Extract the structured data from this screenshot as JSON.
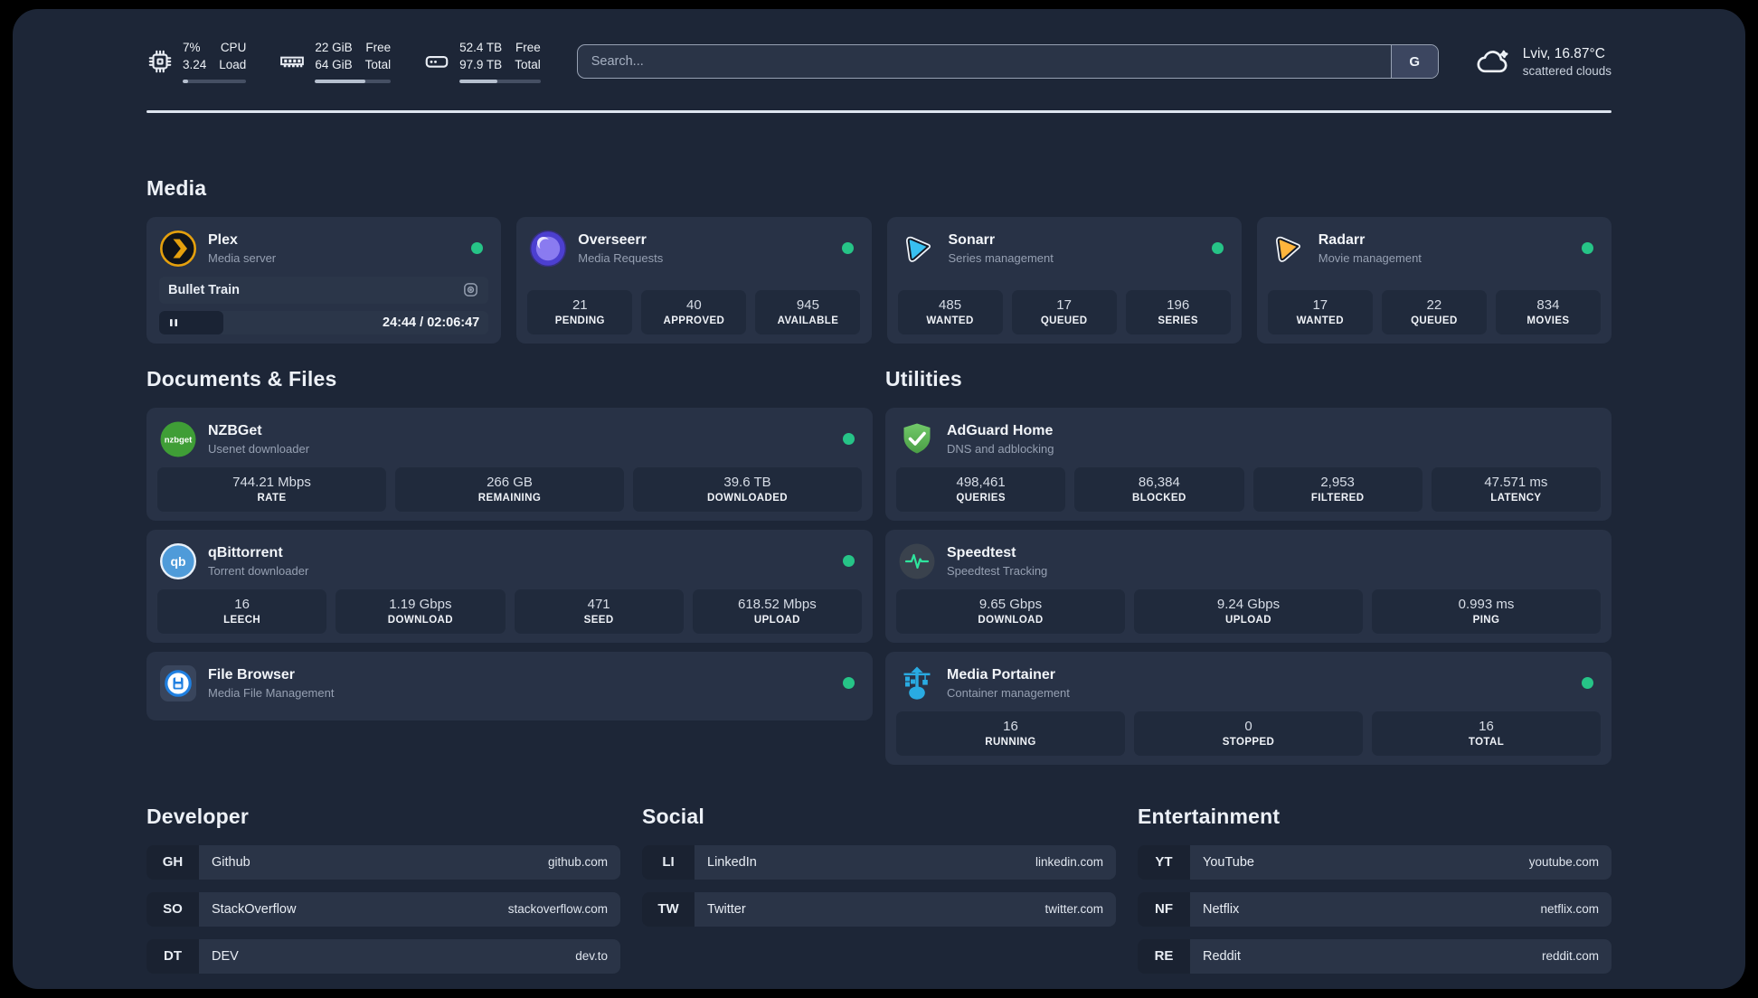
{
  "colors": {
    "status_online": "#26c487",
    "plex_orange": "#e5a00d",
    "overseerr_purple": "#8a7bf0",
    "sonarr_blue": "#38c0f0",
    "radarr_amber": "#ffb53c",
    "nzbget_green": "#3f9e36",
    "qbittorrent_blue": "#4f9bd9",
    "filebrowser_blue": "#1f7fe0",
    "adguard_green": "#5cb85a",
    "speedtest_green": "#2ee59d",
    "portainer_blue": "#29abe2"
  },
  "header": {
    "stats": [
      {
        "id": "cpu",
        "icon": "cpu-icon",
        "values": [
          "7%",
          "3.24"
        ],
        "labels": [
          "CPU",
          "Load"
        ],
        "progress_pct": 8
      },
      {
        "id": "ram",
        "icon": "ram-icon",
        "values": [
          "22 GiB",
          "64 GiB"
        ],
        "labels": [
          "Free",
          "Total"
        ],
        "progress_pct": 66
      },
      {
        "id": "disk",
        "icon": "disk-icon",
        "values": [
          "52.4 TB",
          "97.9 TB"
        ],
        "labels": [
          "Free",
          "Total"
        ],
        "progress_pct": 47
      }
    ],
    "search": {
      "placeholder": "Search...",
      "button_label": "G"
    },
    "weather": {
      "icon": "cloud-icon",
      "location": "Lviv, 16.87°C",
      "condition": "scattered clouds"
    }
  },
  "app_sections": [
    {
      "title": "Media",
      "apps": [
        {
          "id": "plex",
          "icon": "plex-icon",
          "title": "Plex",
          "subtitle": "Media server",
          "online": true,
          "now_playing": {
            "title": "Bullet Train",
            "time_display": "24:44 / 02:06:47",
            "progress_pct": 19.5
          }
        },
        {
          "id": "overseerr",
          "icon": "overseerr-icon",
          "title": "Overseerr",
          "subtitle": "Media Requests",
          "online": true,
          "stats": [
            {
              "value": "21",
              "label": "PENDING"
            },
            {
              "value": "40",
              "label": "APPROVED"
            },
            {
              "value": "945",
              "label": "AVAILABLE"
            }
          ]
        },
        {
          "id": "sonarr",
          "icon": "sonarr-icon",
          "title": "Sonarr",
          "subtitle": "Series management",
          "online": true,
          "stats": [
            {
              "value": "485",
              "label": "WANTED"
            },
            {
              "value": "17",
              "label": "QUEUED"
            },
            {
              "value": "196",
              "label": "SERIES"
            }
          ]
        },
        {
          "id": "radarr",
          "icon": "radarr-icon",
          "title": "Radarr",
          "subtitle": "Movie management",
          "online": true,
          "stats": [
            {
              "value": "17",
              "label": "WANTED"
            },
            {
              "value": "22",
              "label": "QUEUED"
            },
            {
              "value": "834",
              "label": "MOVIES"
            }
          ]
        }
      ]
    },
    {
      "title": "Documents & Files",
      "apps": [
        {
          "id": "nzbget",
          "icon": "nzbget-icon",
          "title": "NZBGet",
          "subtitle": "Usenet downloader",
          "online": true,
          "stats": [
            {
              "value": "744.21 Mbps",
              "label": "RATE"
            },
            {
              "value": "266 GB",
              "label": "REMAINING"
            },
            {
              "value": "39.6 TB",
              "label": "DOWNLOADED"
            }
          ]
        },
        {
          "id": "qbittorrent",
          "icon": "qbittorrent-icon",
          "title": "qBittorrent",
          "subtitle": "Torrent downloader",
          "online": true,
          "stats": [
            {
              "value": "16",
              "label": "LEECH"
            },
            {
              "value": "1.19 Gbps",
              "label": "DOWNLOAD"
            },
            {
              "value": "471",
              "label": "SEED"
            },
            {
              "value": "618.52 Mbps",
              "label": "UPLOAD"
            }
          ]
        },
        {
          "id": "filebrowser",
          "icon": "filebrowser-icon",
          "title": "File Browser",
          "subtitle": "Media File Management",
          "online": true
        }
      ]
    },
    {
      "title": "Utilities",
      "apps": [
        {
          "id": "adguard",
          "icon": "adguard-icon",
          "title": "AdGuard Home",
          "subtitle": "DNS and adblocking",
          "online": false,
          "stats": [
            {
              "value": "498,461",
              "label": "QUERIES"
            },
            {
              "value": "86,384",
              "label": "BLOCKED"
            },
            {
              "value": "2,953",
              "label": "FILTERED"
            },
            {
              "value": "47.571 ms",
              "label": "LATENCY"
            }
          ]
        },
        {
          "id": "speedtest",
          "icon": "speedtest-icon",
          "title": "Speedtest",
          "subtitle": "Speedtest Tracking",
          "online": false,
          "stats": [
            {
              "value": "9.65 Gbps",
              "label": "DOWNLOAD"
            },
            {
              "value": "9.24 Gbps",
              "label": "UPLOAD"
            },
            {
              "value": "0.993 ms",
              "label": "PING"
            }
          ]
        },
        {
          "id": "portainer",
          "icon": "portainer-icon",
          "title": "Media Portainer",
          "subtitle": "Container management",
          "online": true,
          "stats": [
            {
              "value": "16",
              "label": "RUNNING"
            },
            {
              "value": "0",
              "label": "STOPPED"
            },
            {
              "value": "16",
              "label": "TOTAL"
            }
          ]
        }
      ]
    }
  ],
  "bookmark_sections": [
    {
      "title": "Developer",
      "links": [
        {
          "abbr": "GH",
          "name": "Github",
          "host": "github.com"
        },
        {
          "abbr": "SO",
          "name": "StackOverflow",
          "host": "stackoverflow.com"
        },
        {
          "abbr": "DT",
          "name": "DEV",
          "host": "dev.to"
        }
      ]
    },
    {
      "title": "Social",
      "links": [
        {
          "abbr": "LI",
          "name": "LinkedIn",
          "host": "linkedin.com"
        },
        {
          "abbr": "TW",
          "name": "Twitter",
          "host": "twitter.com"
        }
      ]
    },
    {
      "title": "Entertainment",
      "links": [
        {
          "abbr": "YT",
          "name": "YouTube",
          "host": "youtube.com"
        },
        {
          "abbr": "NF",
          "name": "Netflix",
          "host": "netflix.com"
        },
        {
          "abbr": "RE",
          "name": "Reddit",
          "host": "reddit.com"
        }
      ]
    }
  ]
}
